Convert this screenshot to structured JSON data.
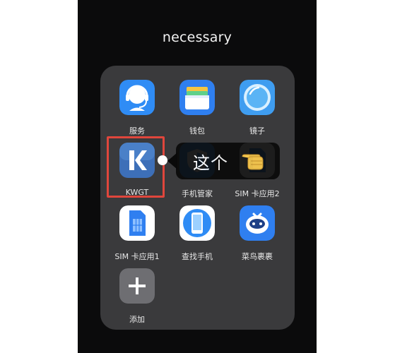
{
  "folder": {
    "title": "necessary"
  },
  "apps": [
    {
      "id": "service",
      "label": "服务",
      "icon": "headset-icon",
      "color": "#2f8cf5"
    },
    {
      "id": "wallet",
      "label": "钱包",
      "icon": "wallet-icon",
      "color": "#2f7ff0"
    },
    {
      "id": "mirror",
      "label": "镜子",
      "icon": "mirror-icon",
      "color": "#4aa8f0"
    },
    {
      "id": "kwgt",
      "label": "KWGT",
      "icon": "kwgt-k-icon",
      "color": "#3d6fb8"
    },
    {
      "id": "phonemgr",
      "label": "手机管家",
      "icon": "shield-icon",
      "color": "#2f8cf5"
    },
    {
      "id": "sim2",
      "label": "SIM 卡应用2",
      "icon": "sim-card-icon",
      "color": "#2f7ff0"
    },
    {
      "id": "sim1",
      "label": "SIM 卡应用1",
      "icon": "sim-card-icon",
      "color": "#2f7ff0"
    },
    {
      "id": "find",
      "label": "查找手机",
      "icon": "find-phone-icon",
      "color": "#2f8cf5"
    },
    {
      "id": "cainiao",
      "label": "菜鸟裹裹",
      "icon": "cainiao-bird-icon",
      "color": "#2f7ff0"
    },
    {
      "id": "add",
      "label": "添加",
      "icon": "plus-icon",
      "color": "#6e6e72"
    }
  ],
  "annotation": {
    "callout_text": "这个",
    "highlight_color": "#e0463c",
    "pointer_icon": "pointing-hand-icon"
  }
}
